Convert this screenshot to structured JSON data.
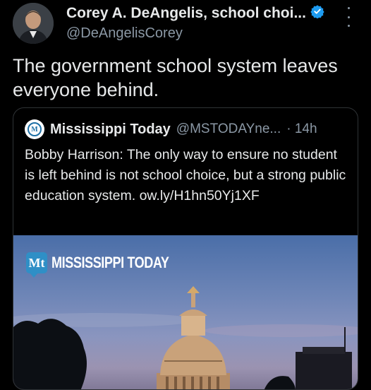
{
  "author": {
    "name": "Corey A. DeAngelis, school choi...",
    "handle": "@DeAngelisCorey",
    "text": "The government school system leaves everyone behind."
  },
  "quoted": {
    "name": "Mississippi Today",
    "handle": "@MSTODAYne...",
    "time": "· 14h",
    "text": "Bobby Harrison: The only way to ensure no student is left behind is not school choice, but a strong public education system. ow.ly/H1hn50Yj1XF",
    "logo_letter": "M",
    "media": {
      "brand_mark": "Mt",
      "brand_text": "MISSISSIPPI TODAY"
    }
  },
  "colors": {
    "background": "#000000",
    "verified": "#1d9bf0",
    "secondary_text": "#8b98a5",
    "brand_blue": "#2f8fc6"
  },
  "icons": {
    "verified": "verified-badge-icon",
    "more": "more-vertical-icon"
  }
}
